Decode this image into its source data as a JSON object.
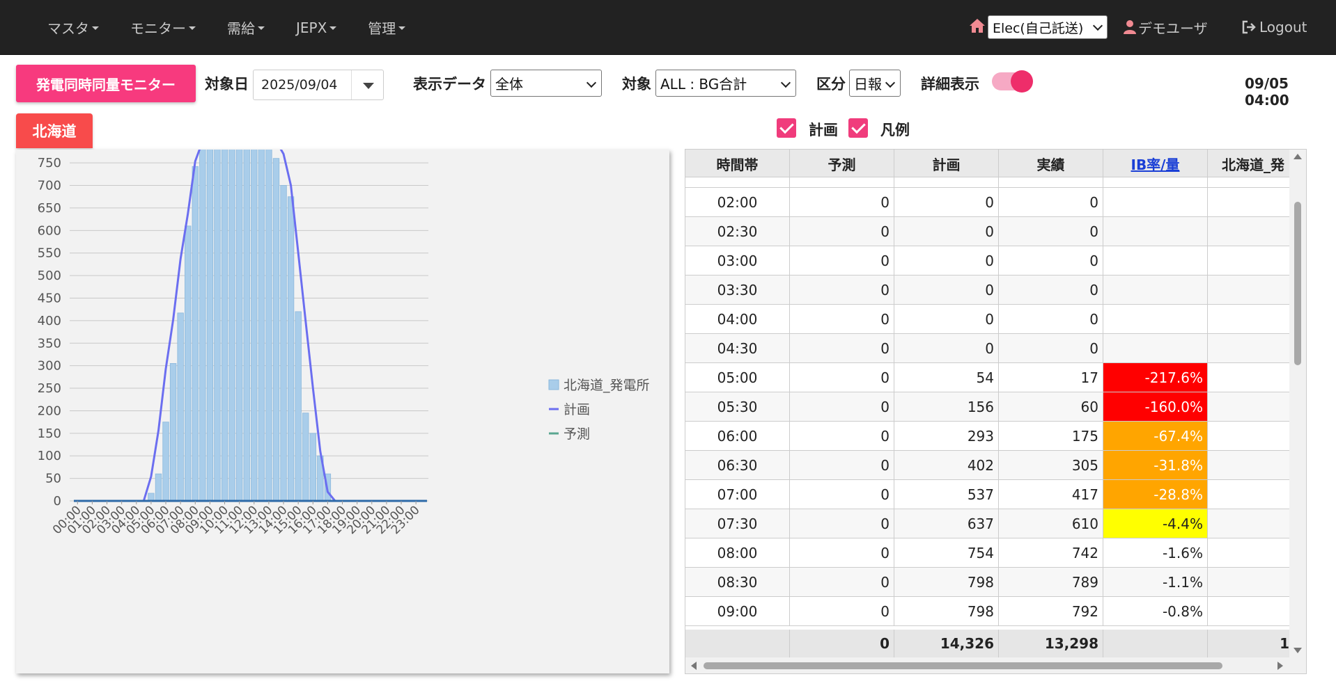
{
  "nav": {
    "menus": [
      "マスタ",
      "モニター",
      "需給",
      "JEPX",
      "管理"
    ],
    "org_select": "Elec(自己託送)",
    "user": "デモユーザ",
    "logout": "Logout",
    "icons": {
      "home": "home-icon",
      "user": "user-icon",
      "logout": "logout-icon"
    }
  },
  "toolbar": {
    "title": "発電同時同量モニター",
    "date_label": "対象日",
    "date_value": "2025/09/04",
    "display_label": "表示データ",
    "display_value": "全体",
    "target_label": "対象",
    "target_value": "ALL : BG合計",
    "category_label": "区分",
    "category_value": "日報",
    "detail_label": "詳細表示",
    "detail_on": true,
    "clock": "09/05 04:00"
  },
  "region_tab": "北海道",
  "checks": {
    "plan_label": "計画",
    "plan_checked": true,
    "legend_label": "凡例",
    "legend_checked": true
  },
  "colors": {
    "accent": "#f73a7e",
    "region": "#f84b4b",
    "bar": "#a9cdea",
    "plan_line": "#6b6ef0",
    "forecast_line": "#5aa690",
    "red": "#ff0000",
    "orange": "#ffa500",
    "yellow": "#ffff00"
  },
  "chart_data": {
    "type": "bar",
    "ylim": [
      0,
      800
    ],
    "yticks": [
      0,
      50,
      100,
      150,
      200,
      250,
      300,
      350,
      400,
      450,
      500,
      550,
      600,
      650,
      700,
      750
    ],
    "xticks": [
      "00:00",
      "01:00",
      "02:00",
      "03:00",
      "04:00",
      "05:00",
      "06:00",
      "07:00",
      "08:00",
      "09:00",
      "10:00",
      "11:00",
      "12:00",
      "13:00",
      "14:00",
      "15:00",
      "16:00",
      "17:00",
      "18:00",
      "19:00",
      "20:00",
      "21:00",
      "22:00",
      "23:00"
    ],
    "categories": [
      "00:00",
      "00:30",
      "01:00",
      "01:30",
      "02:00",
      "02:30",
      "03:00",
      "03:30",
      "04:00",
      "04:30",
      "05:00",
      "05:30",
      "06:00",
      "06:30",
      "07:00",
      "07:30",
      "08:00",
      "08:30",
      "09:00",
      "09:30",
      "10:00",
      "10:30",
      "11:00",
      "11:30",
      "12:00",
      "12:30",
      "13:00",
      "13:30",
      "14:00",
      "14:30",
      "15:00",
      "15:30",
      "16:00",
      "16:30",
      "17:00",
      "17:30",
      "18:00",
      "18:30",
      "19:00",
      "19:30",
      "20:00",
      "20:30",
      "21:00",
      "21:30",
      "22:00",
      "22:30",
      "23:00",
      "23:30"
    ],
    "series": [
      {
        "name": "北海道_発電所",
        "type": "bar",
        "values": [
          0,
          0,
          0,
          0,
          0,
          0,
          0,
          0,
          0,
          0,
          17,
          60,
          175,
          305,
          417,
          610,
          742,
          789,
          792,
          790,
          792,
          790,
          792,
          790,
          792,
          790,
          789,
          760,
          700,
          675,
          420,
          195,
          150,
          100,
          60,
          0,
          0,
          0,
          0,
          0,
          0,
          0,
          0,
          0,
          0,
          0,
          0,
          0
        ]
      },
      {
        "name": "計画",
        "type": "line",
        "values": [
          0,
          0,
          0,
          0,
          0,
          0,
          0,
          0,
          0,
          0,
          54,
          156,
          293,
          402,
          537,
          637,
          754,
          798,
          798,
          798,
          798,
          798,
          798,
          798,
          798,
          798,
          798,
          798,
          770,
          700,
          550,
          400,
          250,
          110,
          20,
          0,
          0,
          0,
          0,
          0,
          0,
          0,
          0,
          0,
          0,
          0,
          0,
          0
        ]
      },
      {
        "name": "予測",
        "type": "line",
        "values": [
          0,
          0,
          0,
          0,
          0,
          0,
          0,
          0,
          0,
          0,
          0,
          0,
          0,
          0,
          0,
          0,
          0,
          0,
          0,
          0,
          0,
          0,
          0,
          0,
          0,
          0,
          0,
          0,
          0,
          0,
          0,
          0,
          0,
          0,
          0,
          0,
          0,
          0,
          0,
          0,
          0,
          0,
          0,
          0,
          0,
          0,
          0,
          0
        ]
      }
    ],
    "legend": [
      "北海道_発電所",
      "計画",
      "予測"
    ],
    "legend_position": "right",
    "grid": true
  },
  "table": {
    "headers": [
      "時間帯",
      "予測",
      "計画",
      "実績",
      "IB率/量",
      "北海道_発"
    ],
    "rows": [
      {
        "time": "02:00",
        "forecast": "0",
        "plan": "0",
        "actual": "0",
        "ib": "",
        "ib_level": "none"
      },
      {
        "time": "02:30",
        "forecast": "0",
        "plan": "0",
        "actual": "0",
        "ib": "",
        "ib_level": "none"
      },
      {
        "time": "03:00",
        "forecast": "0",
        "plan": "0",
        "actual": "0",
        "ib": "",
        "ib_level": "none"
      },
      {
        "time": "03:30",
        "forecast": "0",
        "plan": "0",
        "actual": "0",
        "ib": "",
        "ib_level": "none"
      },
      {
        "time": "04:00",
        "forecast": "0",
        "plan": "0",
        "actual": "0",
        "ib": "",
        "ib_level": "none"
      },
      {
        "time": "04:30",
        "forecast": "0",
        "plan": "0",
        "actual": "0",
        "ib": "",
        "ib_level": "none"
      },
      {
        "time": "05:00",
        "forecast": "0",
        "plan": "54",
        "actual": "17",
        "ib": "-217.6%",
        "ib_level": "red"
      },
      {
        "time": "05:30",
        "forecast": "0",
        "plan": "156",
        "actual": "60",
        "ib": "-160.0%",
        "ib_level": "red"
      },
      {
        "time": "06:00",
        "forecast": "0",
        "plan": "293",
        "actual": "175",
        "ib": "-67.4%",
        "ib_level": "orange"
      },
      {
        "time": "06:30",
        "forecast": "0",
        "plan": "402",
        "actual": "305",
        "ib": "-31.8%",
        "ib_level": "orange"
      },
      {
        "time": "07:00",
        "forecast": "0",
        "plan": "537",
        "actual": "417",
        "ib": "-28.8%",
        "ib_level": "orange"
      },
      {
        "time": "07:30",
        "forecast": "0",
        "plan": "637",
        "actual": "610",
        "ib": "-4.4%",
        "ib_level": "yellow"
      },
      {
        "time": "08:00",
        "forecast": "0",
        "plan": "754",
        "actual": "742",
        "ib": "-1.6%",
        "ib_level": "none"
      },
      {
        "time": "08:30",
        "forecast": "0",
        "plan": "798",
        "actual": "789",
        "ib": "-1.1%",
        "ib_level": "none"
      },
      {
        "time": "09:00",
        "forecast": "0",
        "plan": "798",
        "actual": "792",
        "ib": "-0.8%",
        "ib_level": "none"
      }
    ],
    "totals": {
      "time": "",
      "forecast": "0",
      "plan": "14,326",
      "actual": "13,298",
      "ib": "",
      "extra": "1"
    }
  }
}
